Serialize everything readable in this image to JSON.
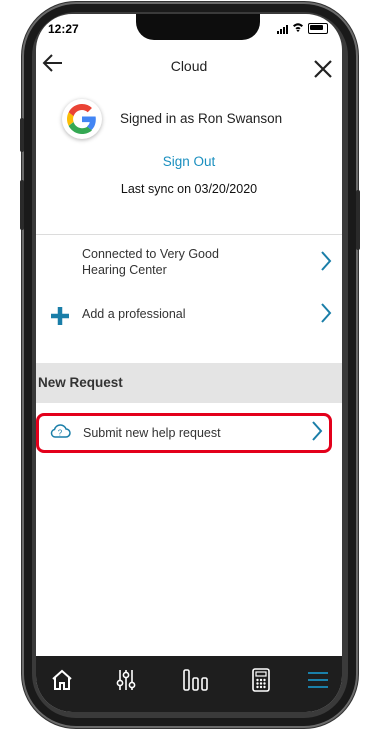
{
  "status_bar": {
    "time": "12:27"
  },
  "nav": {
    "title": "Cloud"
  },
  "account": {
    "signed_in_text": "Signed in as Ron Swanson",
    "sign_out_label": "Sign Out",
    "last_sync": "Last sync on 03/20/2020",
    "provider_icon": "google-icon"
  },
  "rows": {
    "connected_line1": "Connected to Very Good",
    "connected_line2": "Hearing Center",
    "add_professional": "Add a professional"
  },
  "section": {
    "title": "New Request"
  },
  "help": {
    "label": "Submit new help request",
    "highlight_color": "#e3001b"
  },
  "tabs": [
    "home-icon",
    "sliders-icon",
    "bars-icon",
    "remote-icon",
    "menu-icon"
  ],
  "colors": {
    "accent": "#1a8fbf",
    "tabbar": "#1e1e1e",
    "active_tab": "#1a8fbf"
  }
}
